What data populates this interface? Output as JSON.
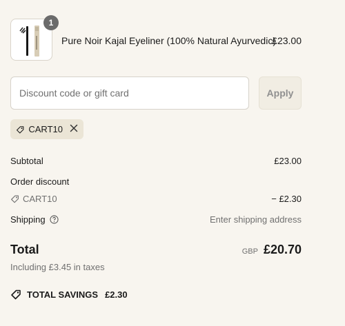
{
  "product": {
    "name": "Pure Noir Kajal Eyeliner (100% Natural Ayurvedic)",
    "price": "£23.00",
    "quantity": "1",
    "image_icon": "kajal-eyeliner-product-image"
  },
  "discount": {
    "placeholder": "Discount code or gift card",
    "value": "",
    "apply_label": "Apply"
  },
  "applied_code": {
    "code": "CART10",
    "tag_icon": "tag-icon",
    "remove_icon": "close-icon"
  },
  "summary": {
    "subtotal_label": "Subtotal",
    "subtotal_value": "£23.00",
    "order_discount_label": "Order discount",
    "discount_code": "CART10",
    "discount_value": "− £2.30",
    "shipping_label": "Shipping",
    "shipping_value": "Enter shipping address",
    "shipping_help_icon": "help-circle-icon"
  },
  "total": {
    "label": "Total",
    "currency": "GBP",
    "amount": "£20.70",
    "tax_note": "Including £3.45 in taxes"
  },
  "savings": {
    "label": "TOTAL SAVINGS",
    "value": "£2.30",
    "icon": "tag-icon"
  },
  "colors": {
    "background": "#f8f5ef",
    "chip": "#ebe5d6",
    "badge": "#6b6b6b"
  }
}
